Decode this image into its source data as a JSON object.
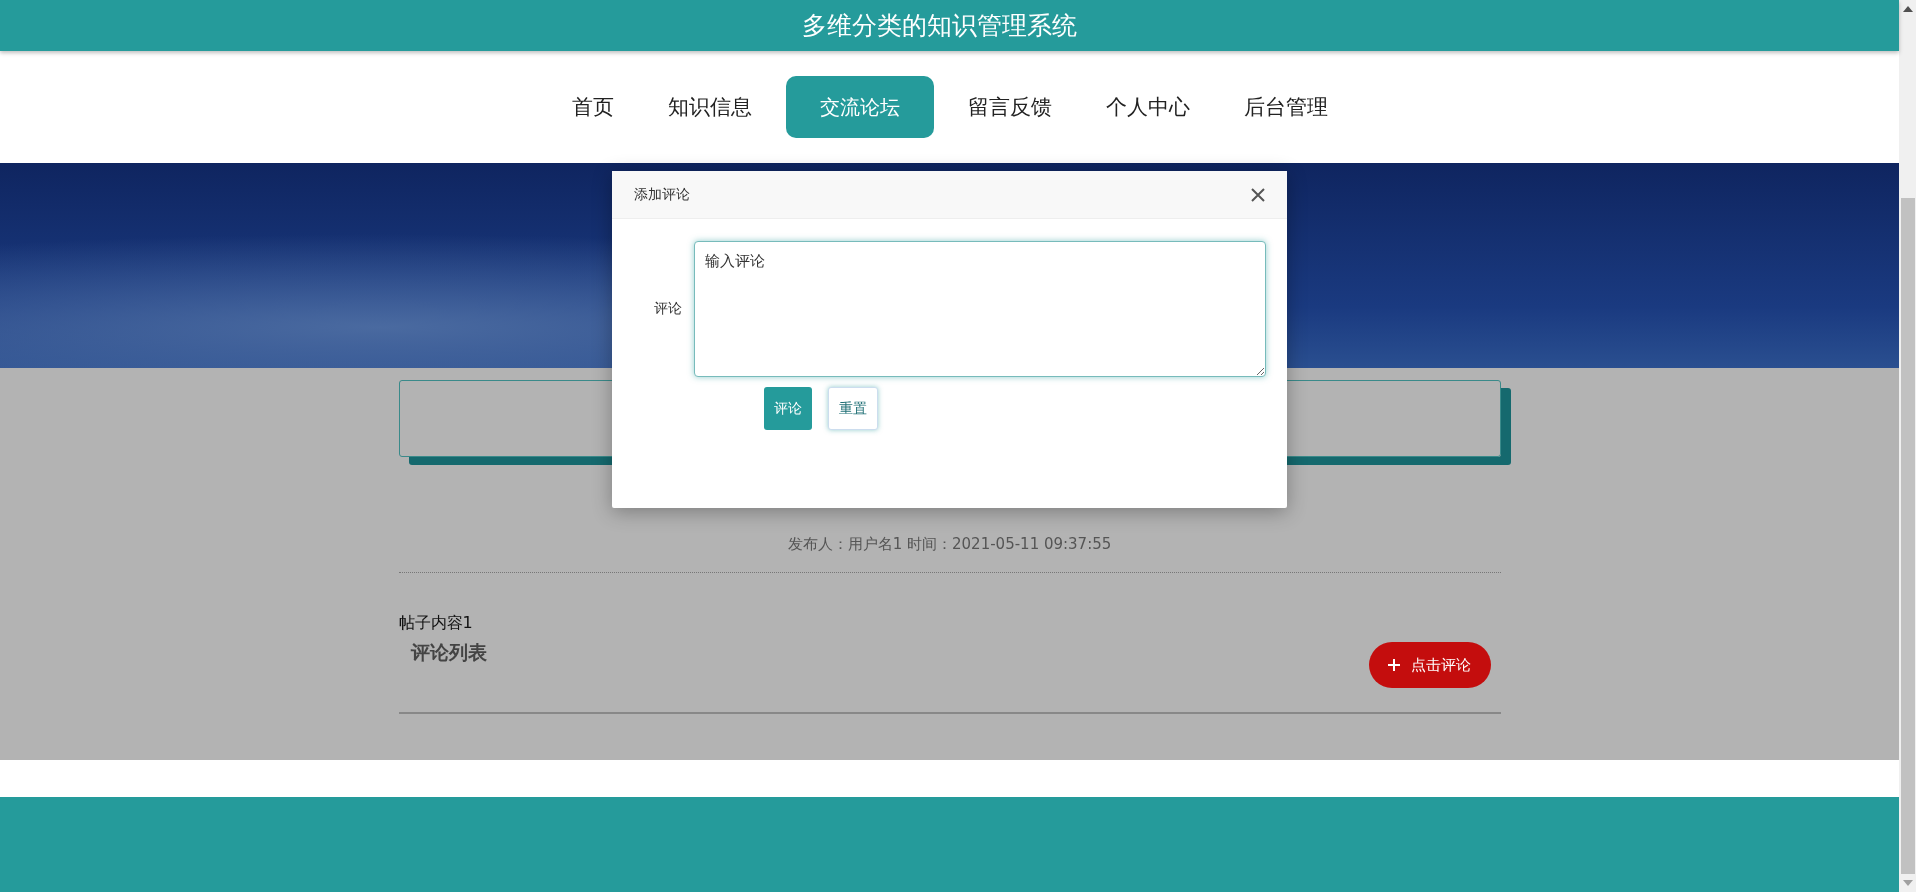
{
  "site_title": "多维分类的知识管理系统",
  "nav": [
    {
      "label": "首页",
      "selected": false
    },
    {
      "label": "知识信息",
      "selected": false
    },
    {
      "label": "交流论坛",
      "selected": true
    },
    {
      "label": "留言反馈",
      "selected": false
    },
    {
      "label": "个人中心",
      "selected": false
    },
    {
      "label": "后台管理",
      "selected": false
    }
  ],
  "post": {
    "meta": "发布人：用户名1 时间：2021-05-11 09:37:55",
    "content": "帖子内容1",
    "comments_heading": "评论列表",
    "comment_button": "点击评论"
  },
  "dialog": {
    "title": "添加评论",
    "field_label": "评论",
    "field_value": "输入评论",
    "buttons": [
      {
        "label": "评论",
        "kind": "primary"
      },
      {
        "label": "重置",
        "kind": "secondary"
      }
    ]
  }
}
